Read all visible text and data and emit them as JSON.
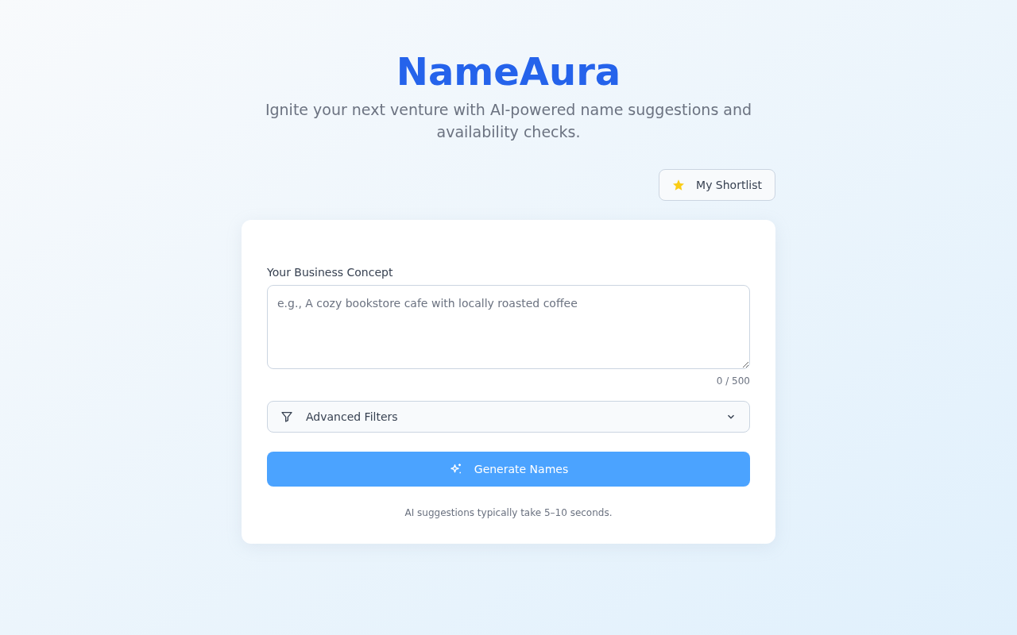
{
  "header": {
    "title": "NameAura",
    "subtitle": "Ignite your next venture with AI-powered name suggestions and availability checks."
  },
  "shortlist_button": {
    "label": "My Shortlist"
  },
  "form": {
    "concept_label": "Your Business Concept",
    "concept_field": {
      "placeholder": "e.g., A cozy bookstore cafe with locally roasted coffee"
    },
    "char_count": "0 / 500",
    "advanced_filters": {
      "label": "Advanced Filters",
      "expanded": false
    },
    "generate_button": {
      "label": "Generate Names"
    },
    "note": "AI suggestions typically take 5–10 seconds."
  }
}
